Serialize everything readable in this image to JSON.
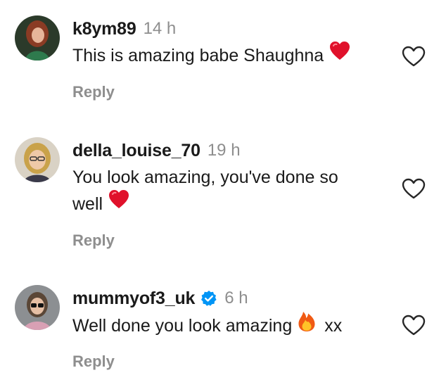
{
  "comments": [
    {
      "username": "k8ym89",
      "time": "14 h",
      "text": "This is amazing babe Shaughna",
      "emoji": "red-heart",
      "verified": false,
      "reply_label": "Reply"
    },
    {
      "username": "della_louise_70",
      "time": "19 h",
      "text_line1": "You look amazing, you've done so",
      "text_line2": "well",
      "emoji": "red-heart",
      "verified": false,
      "reply_label": "Reply"
    },
    {
      "username": "mummyof3_uk",
      "time": "6 h",
      "text": "Well done you look amazing",
      "emoji": "fire",
      "text_after": "xx",
      "verified": true,
      "reply_label": "Reply"
    }
  ],
  "colors": {
    "username": "#1a1a1a",
    "muted": "#8e8e8e",
    "heart": "#e0112b",
    "verified": "#0095f6"
  }
}
